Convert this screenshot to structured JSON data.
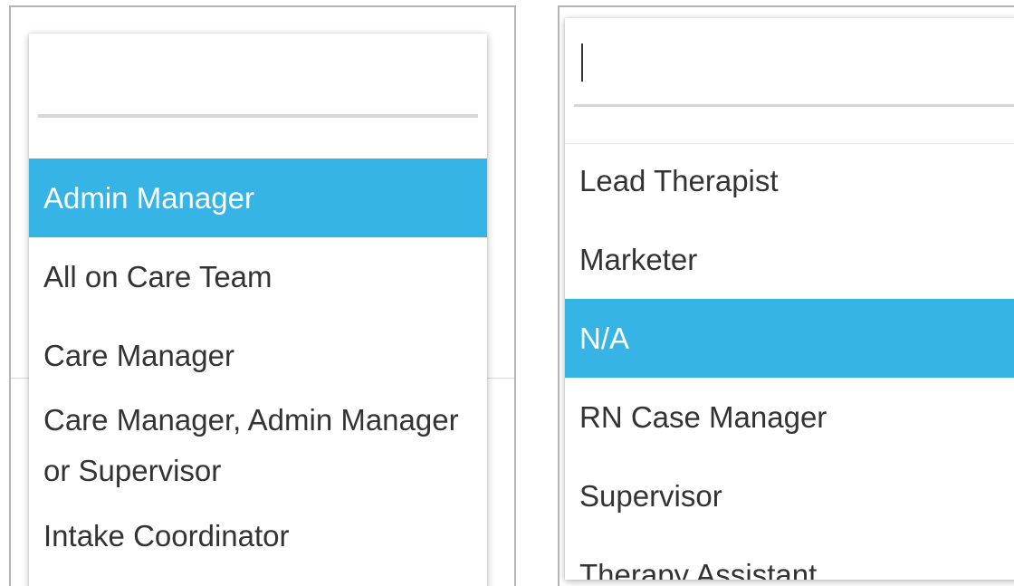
{
  "left_panel": {
    "search": {
      "value": "",
      "placeholder": ""
    },
    "options": [
      {
        "label": "Admin Manager",
        "selected": true
      },
      {
        "label": "All on Care Team",
        "selected": false
      },
      {
        "label": "Care Manager",
        "selected": false
      },
      {
        "label": "Care Manager, Admin Manager or Supervisor",
        "selected": false
      },
      {
        "label": "Intake Coordinator",
        "selected": false
      }
    ]
  },
  "right_panel": {
    "search": {
      "value": "",
      "placeholder": ""
    },
    "options": [
      {
        "label": "Lead Therapist",
        "selected": false
      },
      {
        "label": "Marketer",
        "selected": false
      },
      {
        "label": "N/A",
        "selected": true
      },
      {
        "label": "RN Case Manager",
        "selected": false
      },
      {
        "label": "Supervisor",
        "selected": false
      },
      {
        "label": "Therapy Assistant",
        "selected": false
      }
    ]
  },
  "colors": {
    "selected_background": "#35b4e5",
    "selected_text": "#ffffff",
    "option_text": "#333333",
    "frame_border": "#b4b4b4"
  }
}
